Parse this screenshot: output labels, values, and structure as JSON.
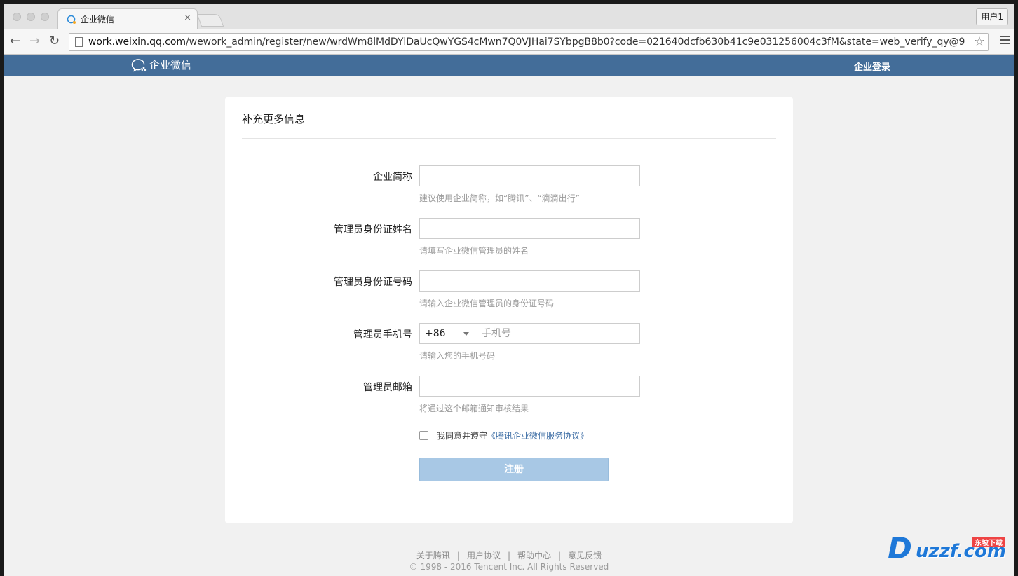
{
  "browser": {
    "tab_title": "企业微信",
    "profile": "用户1",
    "url_host": "work.weixin.qq.com",
    "url_rest": "/wework_admin/register/new/wrdWm8lMdDYlDaUcQwYGS4cMwn7Q0VJHai7SYbpgB8b0?code=021640dcfb630b41c9e031256004c3fM&state=web_verify_qy@9"
  },
  "site": {
    "logo_text": "企业微信",
    "login_link": "企业登录",
    "brand_color": "#436d99"
  },
  "form": {
    "title": "补充更多信息",
    "fields": [
      {
        "label": "企业简称",
        "value": "",
        "hint": "建议使用企业简称，如“腾讯”、“滴滴出行”"
      },
      {
        "label": "管理员身份证姓名",
        "value": "",
        "hint": "请填写企业微信管理员的姓名"
      },
      {
        "label": "管理员身份证号码",
        "value": "",
        "hint": "请输入企业微信管理员的身份证号码"
      },
      {
        "label": "管理员手机号",
        "country_code": "+86",
        "placeholder": "手机号",
        "hint": "请输入您的手机号码"
      },
      {
        "label": "管理员邮箱",
        "value": "",
        "hint": "将通过这个邮箱通知审核结果"
      }
    ],
    "agree_text": "我同意并遵守",
    "agree_link": "《腾讯企业微信服务协议》",
    "agree_checked": false,
    "submit_label": "注册"
  },
  "footer": {
    "links": [
      "关于腾讯",
      "用户协议",
      "帮助中心",
      "意见反馈"
    ],
    "copyright": "© 1998 - 2016 Tencent Inc. All Rights Reserved"
  },
  "watermark": {
    "text": "uzzf.com",
    "badge": "东坡下载"
  }
}
